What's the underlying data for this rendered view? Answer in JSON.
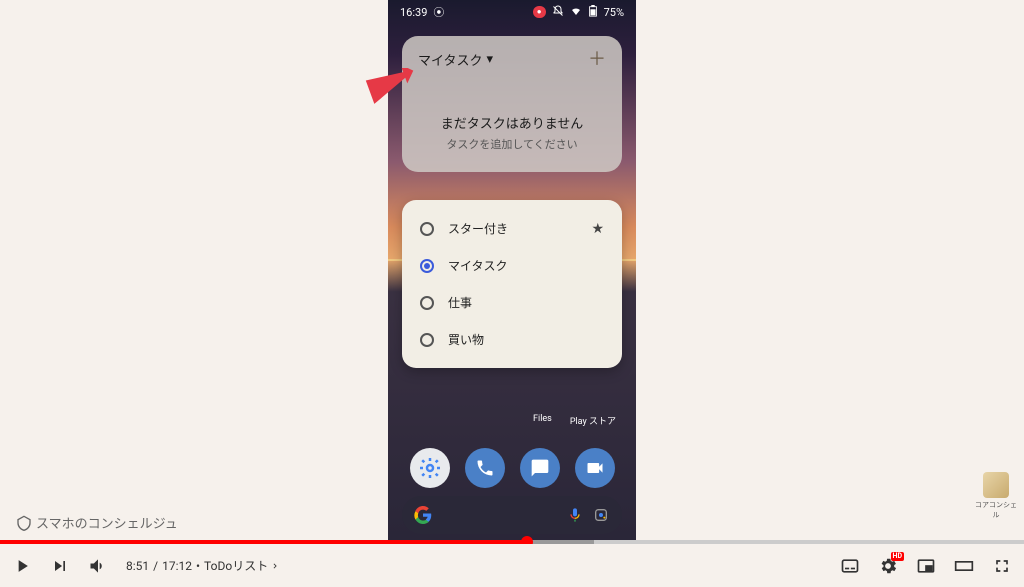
{
  "status_bar": {
    "time": "16:39",
    "battery": "75%"
  },
  "widget": {
    "title": "マイタスク",
    "empty_title": "まだタスクはありません",
    "empty_sub": "タスクを追加してください"
  },
  "popup_items": [
    {
      "label": "スター付き",
      "starred": true,
      "selected": false
    },
    {
      "label": "マイタスク",
      "starred": false,
      "selected": true
    },
    {
      "label": "仕事",
      "starred": false,
      "selected": false
    },
    {
      "label": "買い物",
      "starred": false,
      "selected": false
    }
  ],
  "app_labels": {
    "files": "Files",
    "play": "Play ストア"
  },
  "player": {
    "current_time": "8:51",
    "duration": "17:12",
    "chapter": "ToDoリスト",
    "progress_pct": 51.5,
    "loaded_pct": 58
  },
  "watermark": "スマホのコンシェルジュ",
  "side_label": "コアコンシェル",
  "hd_label": "HD"
}
